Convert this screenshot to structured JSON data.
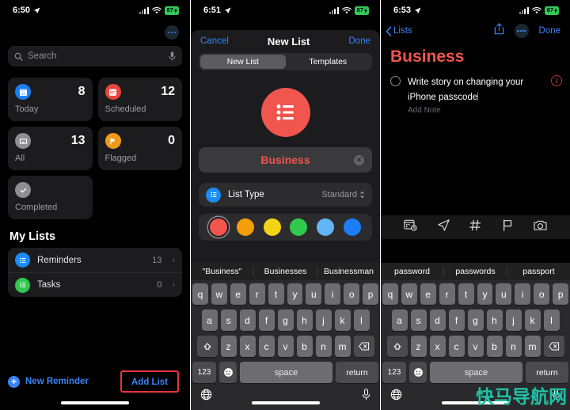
{
  "panel1": {
    "statusbar": {
      "time": "6:50",
      "battery": "87",
      "location_icon": "location-arrow-icon",
      "wifi_icon": "wifi-icon",
      "signal_icon": "cellular-signal-icon"
    },
    "more_button": "more-options-icon",
    "search": {
      "placeholder": "Search",
      "icon": "search-icon",
      "mic_icon": "microphone-icon"
    },
    "cards": [
      {
        "label": "Today",
        "count": "8",
        "icon": "calendar-today-icon",
        "color": "#1b7ef5"
      },
      {
        "label": "Scheduled",
        "count": "12",
        "icon": "calendar-scheduled-icon",
        "color": "#e8453c"
      },
      {
        "label": "All",
        "count": "13",
        "icon": "inbox-tray-icon",
        "color": "#8e8e93"
      },
      {
        "label": "Flagged",
        "count": "0",
        "icon": "flag-icon",
        "color": "#f09a1c"
      },
      {
        "label": "Completed",
        "count": "",
        "icon": "checkmark-icon",
        "color": "#8e8e93"
      }
    ],
    "my_lists_title": "My Lists",
    "lists": [
      {
        "name": "Reminders",
        "count": "13",
        "color": "#1b8cf5"
      },
      {
        "name": "Tasks",
        "count": "0",
        "color": "#30c94e"
      }
    ],
    "new_reminder": "New Reminder",
    "add_list": "Add List",
    "highlight_color": "#e8343f"
  },
  "panel2": {
    "statusbar": {
      "time": "6:51",
      "battery": "87"
    },
    "nav": {
      "cancel": "Cancel",
      "title": "New List",
      "done": "Done"
    },
    "segments": [
      {
        "label": "New List",
        "selected": true
      },
      {
        "label": "Templates",
        "selected": false
      }
    ],
    "list_icon": "bulleted-list-icon",
    "list_icon_color": "#f0554e",
    "name_value": "Business",
    "clear_icon": "clear-text-icon",
    "type_row": {
      "label": "List Type",
      "value": "Standard",
      "icon": "list-type-icon",
      "chevron": "updown-chevron-icon"
    },
    "swatches": [
      {
        "color": "#f0554e",
        "selected": true
      },
      {
        "color": "#f59e0b",
        "selected": false
      },
      {
        "color": "#f5d415",
        "selected": false
      },
      {
        "color": "#30c94e",
        "selected": false
      },
      {
        "color": "#64b5f6",
        "selected": false
      },
      {
        "color": "#1b7ef5",
        "selected": false
      }
    ],
    "suggestions": [
      "\"Business\"",
      "Businesses",
      "Businessman"
    ],
    "keyboard": {
      "row1": [
        "q",
        "w",
        "e",
        "r",
        "t",
        "y",
        "u",
        "i",
        "o",
        "p"
      ],
      "row2": [
        "a",
        "s",
        "d",
        "f",
        "g",
        "h",
        "j",
        "k",
        "l"
      ],
      "row3": [
        "z",
        "x",
        "c",
        "v",
        "b",
        "n",
        "m"
      ],
      "shift": "shift-key-icon",
      "backspace": "backspace-key-icon",
      "numbers": "123",
      "emoji": "emoji-key-icon",
      "space": "space",
      "return": "return",
      "globe": "globe-key-icon",
      "dictation": "dictation-mic-icon"
    }
  },
  "panel3": {
    "statusbar": {
      "time": "6:53",
      "battery": "87"
    },
    "nav": {
      "back": "Lists",
      "share": "share-icon",
      "more": "more-options-icon",
      "done": "Done"
    },
    "title": "Business",
    "reminder": {
      "text": "Write story on changing your iPhone passcode",
      "note_placeholder": "Add Note",
      "info": "info-icon",
      "checkbox": "reminder-circle-icon"
    },
    "toolbar": [
      "calendar-clock-icon",
      "location-arrow-icon",
      "hashtag-icon",
      "flag-icon",
      "camera-icon"
    ],
    "suggestions": [
      "password",
      "passwords",
      "passport"
    ],
    "keyboard": {
      "row1": [
        "q",
        "w",
        "e",
        "r",
        "t",
        "y",
        "u",
        "i",
        "o",
        "p"
      ],
      "row2": [
        "a",
        "s",
        "d",
        "f",
        "g",
        "h",
        "j",
        "k",
        "l"
      ],
      "row3": [
        "z",
        "x",
        "c",
        "v",
        "b",
        "n",
        "m"
      ],
      "numbers": "123",
      "space": "space",
      "return": "return"
    },
    "watermark": "快马导航网"
  }
}
